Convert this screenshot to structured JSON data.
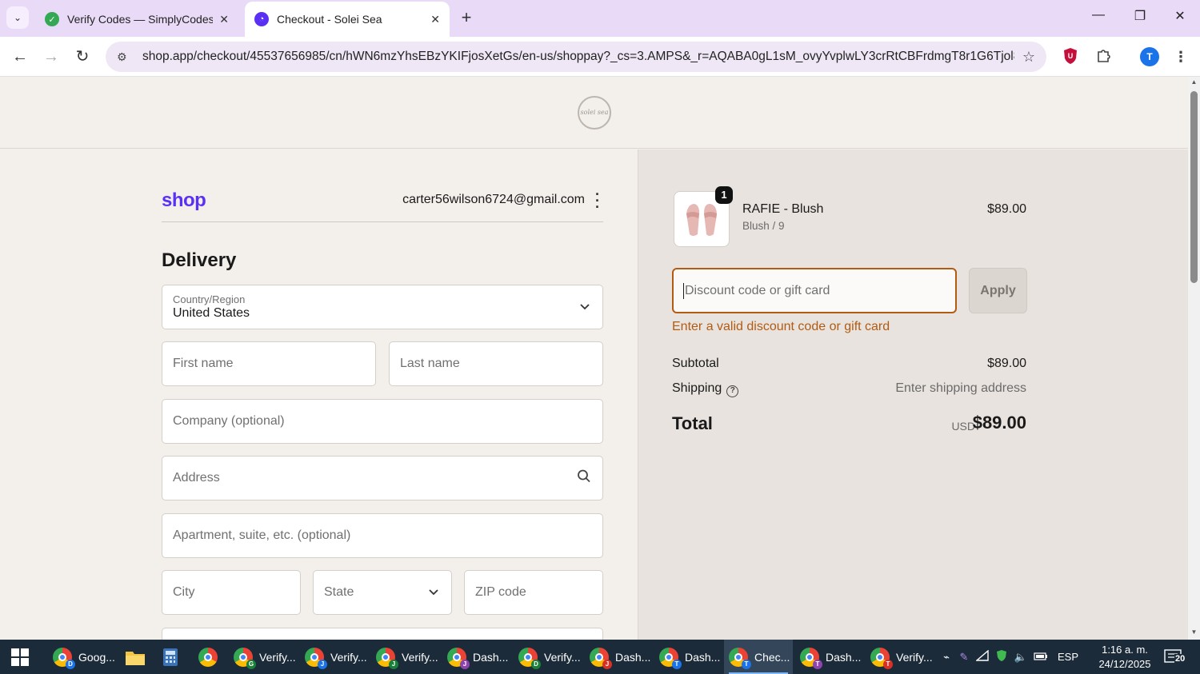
{
  "browser": {
    "tabs": [
      {
        "title": "Verify Codes — SimplyCodes",
        "active": false
      },
      {
        "title": "Checkout - Solei Sea",
        "active": true
      }
    ],
    "url": "shop.app/checkout/45537656985/cn/hWN6mzYhsEBzYKIFjosXetGs/en-us/shoppay?_cs=3.AMPS&_r=AQABA0gL1sM_ovyYvplwLY3crRtCBFrdmgT8r1G6Tjol8YI...",
    "profile_initial": "T"
  },
  "store": {
    "logo_text": "solei sea"
  },
  "checkout": {
    "shop_brand": "shop",
    "email": "carter56wilson6724@gmail.com",
    "delivery_title": "Delivery",
    "country": {
      "label": "Country/Region",
      "value": "United States"
    },
    "first_name_placeholder": "First name",
    "last_name_placeholder": "Last name",
    "company_placeholder": "Company (optional)",
    "address_placeholder": "Address",
    "apartment_placeholder": "Apartment, suite, etc. (optional)",
    "city_placeholder": "City",
    "state_placeholder": "State",
    "zip_placeholder": "ZIP code"
  },
  "summary": {
    "product": {
      "name": "RAFIE - Blush",
      "variant": "Blush / 9",
      "price": "$89.00",
      "quantity": "1"
    },
    "discount_placeholder": "Discount code or gift card",
    "apply_label": "Apply",
    "error_message": "Enter a valid discount code or gift card",
    "subtotal_label": "Subtotal",
    "subtotal_value": "$89.00",
    "shipping_label": "Shipping",
    "shipping_value": "Enter shipping address",
    "total_label": "Total",
    "total_currency": "USD",
    "total_value": "$89.00"
  },
  "taskbar": {
    "items": [
      {
        "label": "Goog...",
        "badge": "D",
        "badge_color": "#1a73e8"
      },
      {
        "label": "Verify...",
        "badge": "G",
        "badge_color": "#188038"
      },
      {
        "label": "Verify...",
        "badge": "J",
        "badge_color": "#1a73e8"
      },
      {
        "label": "Verify...",
        "badge": "J",
        "badge_color": "#188038"
      },
      {
        "label": "Dash...",
        "badge": "J",
        "badge_color": "#8e44ad"
      },
      {
        "label": "Verify...",
        "badge": "D",
        "badge_color": "#188038"
      },
      {
        "label": "Dash...",
        "badge": "J",
        "badge_color": "#d93025"
      },
      {
        "label": "Dash...",
        "badge": "T",
        "badge_color": "#1a73e8"
      },
      {
        "label": "Chec...",
        "badge": "T",
        "badge_color": "#1a73e8",
        "active": true
      },
      {
        "label": "Dash...",
        "badge": "T",
        "badge_color": "#8e44ad"
      },
      {
        "label": "Verify...",
        "badge": "T",
        "badge_color": "#d93025"
      }
    ],
    "language": "ESP",
    "time": "1:16 a. m.",
    "date": "24/12/2025",
    "notifications": "20"
  }
}
